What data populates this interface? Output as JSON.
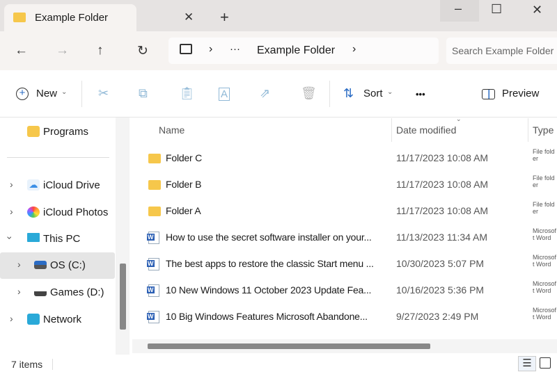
{
  "window": {
    "tab_title": "Example Folder",
    "new_tab": "+",
    "minimize": "–",
    "maximize": "☐",
    "close": "✕",
    "tab_close": "✕"
  },
  "address": {
    "back": "←",
    "forward": "→",
    "up": "↑",
    "refresh": "↻",
    "ellipsis": "···",
    "crumb": "Example Folder",
    "search_placeholder": "Search Example Folder"
  },
  "toolbar": {
    "new": "New",
    "sort": "Sort",
    "more": "•••",
    "preview": "Preview"
  },
  "sidebar": {
    "items": [
      {
        "label": "Programs",
        "icon": "folder-icon"
      },
      {
        "label": "iCloud Drive",
        "icon": "icloud-drive-icon"
      },
      {
        "label": "iCloud Photos",
        "icon": "icloud-photos-icon"
      },
      {
        "label": "This PC",
        "icon": "pc-icon"
      },
      {
        "label": "OS (C:)",
        "icon": "drive-icon",
        "selected": true
      },
      {
        "label": "Games (D:)",
        "icon": "drive-icon"
      },
      {
        "label": "Network",
        "icon": "network-icon"
      }
    ]
  },
  "columns": {
    "name": "Name",
    "date": "Date modified",
    "type": "Type"
  },
  "files": [
    {
      "name": "Folder C",
      "date": "11/17/2023 10:08 AM",
      "type": "File folder",
      "kind": "folder"
    },
    {
      "name": "Folder B",
      "date": "11/17/2023 10:08 AM",
      "type": "File folder",
      "kind": "folder"
    },
    {
      "name": "Folder A",
      "date": "11/17/2023 10:08 AM",
      "type": "File folder",
      "kind": "folder"
    },
    {
      "name": "How to use the secret software installer on your...",
      "date": "11/13/2023 11:34 AM",
      "type": "Microsoft Word",
      "kind": "word"
    },
    {
      "name": "The best apps to restore the classic Start menu ...",
      "date": "10/30/2023 5:07 PM",
      "type": "Microsoft Word",
      "kind": "word"
    },
    {
      "name": "10 New Windows 11 October 2023 Update Fea...",
      "date": "10/16/2023 5:36 PM",
      "type": "Microsoft Word",
      "kind": "word"
    },
    {
      "name": "10 Big Windows Features Microsoft Abandone...",
      "date": "9/27/2023 2:49 PM",
      "type": "Microsoft Word",
      "kind": "word"
    }
  ],
  "status": {
    "count": "7 items"
  }
}
